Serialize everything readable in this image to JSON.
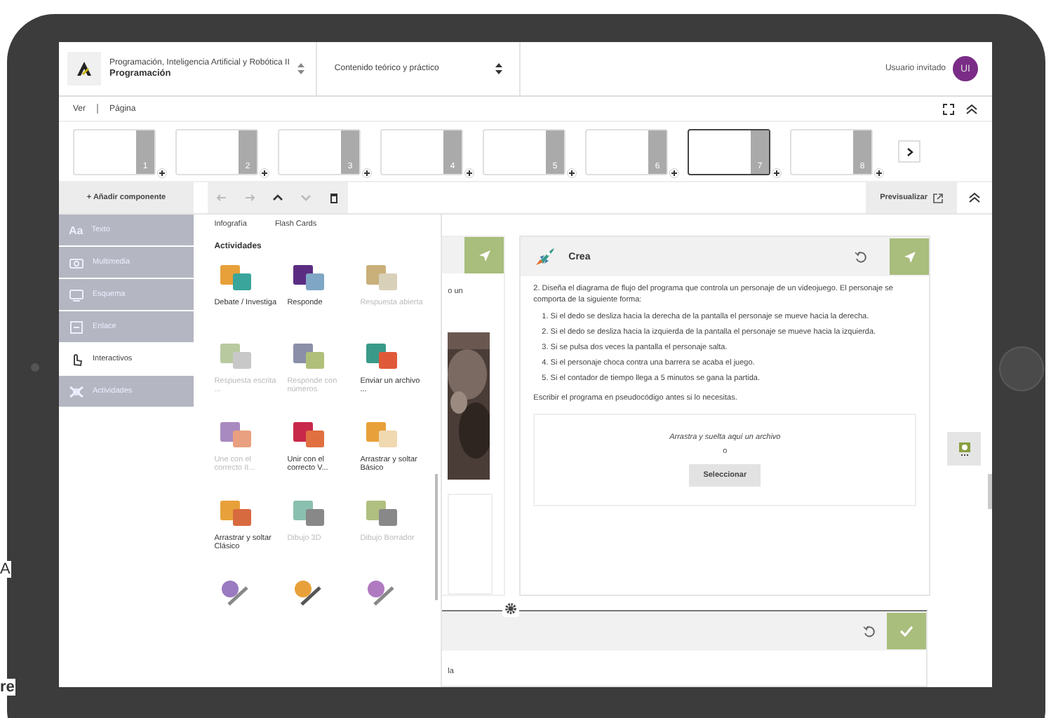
{
  "background_texts": [
    "A",
    "re"
  ],
  "header": {
    "course": "Programación, Inteligencia Artificial y Robótica II",
    "unit": "Programación",
    "section": "Contenido teórico y práctico",
    "user": "Usuario invitado",
    "initials": "UI"
  },
  "menu": [
    "Ver",
    "Página"
  ],
  "pages": [
    {
      "number": "1",
      "selected": false
    },
    {
      "number": "2",
      "selected": false
    },
    {
      "number": "3",
      "selected": false
    },
    {
      "number": "4",
      "selected": false
    },
    {
      "number": "5",
      "selected": false
    },
    {
      "number": "6",
      "selected": false
    },
    {
      "number": "7",
      "selected": true
    },
    {
      "number": "8",
      "selected": false
    }
  ],
  "toolbar": {
    "add": "+ Añadir componente",
    "buttons": [
      {
        "kind": "left",
        "disabled": true
      },
      {
        "kind": "right",
        "disabled": true
      },
      {
        "kind": "up",
        "disabled": false
      },
      {
        "kind": "down",
        "disabled": true
      },
      {
        "kind": "trash",
        "disabled": false
      }
    ],
    "preview": "Previsualizar"
  },
  "sidebar": [
    {
      "kind": "text",
      "glyph": "Aa",
      "label": "Texto",
      "selected": false
    },
    {
      "kind": "media",
      "label": "Multimedia",
      "selected": false
    },
    {
      "kind": "scheme",
      "label": "Esquema",
      "selected": false
    },
    {
      "kind": "link",
      "label": "Enlace",
      "selected": false
    },
    {
      "kind": "interactive",
      "label": "Interactivos",
      "selected": true
    },
    {
      "kind": "activity",
      "label": "Actividades",
      "selected": false
    }
  ],
  "palette": {
    "top_items": [
      "Infografía",
      "Flash Cards"
    ],
    "heading": "Actividades",
    "items": [
      {
        "kind": "tile",
        "label": "Debate / Investiga",
        "disabled": false
      },
      {
        "kind": "tile",
        "label": "Responde",
        "disabled": false
      },
      {
        "kind": "tile",
        "label": "Respuesta abierta",
        "disabled": true
      },
      {
        "kind": "tile",
        "label": "Respuesta escrita ...",
        "disabled": true
      },
      {
        "kind": "tile",
        "label": "Responde con números",
        "disabled": true
      },
      {
        "kind": "tile",
        "label": "Enviar un archivo ...",
        "disabled": false
      },
      {
        "kind": "tile",
        "label": "Une con el correcto II...",
        "disabled": true
      },
      {
        "kind": "tile",
        "label": "Unir con el correcto V...",
        "disabled": false
      },
      {
        "kind": "tile",
        "label": "Arrastrar y soltar Básico",
        "disabled": false
      },
      {
        "kind": "tile",
        "label": "Arrastrar y soltar Clásico",
        "disabled": false
      },
      {
        "kind": "tile",
        "label": "Dibujo 3D",
        "disabled": true
      },
      {
        "kind": "tile",
        "label": "Dibujo Borrador",
        "disabled": true
      },
      {
        "kind": "cut"
      },
      {
        "kind": "cut"
      },
      {
        "kind": "cut"
      }
    ]
  },
  "left_card": {
    "text": "o un"
  },
  "crea_card": {
    "title": "Crea",
    "intro": "2. Diseña el diagrama de flujo del programa que controla un personaje de un videojuego. El personaje se comporta de la siguiente forma:",
    "steps": [
      "1. Si el dedo se desliza hacia la derecha de la pantalla el personaje se mueve hacia la derecha.",
      "2. Si el dedo se desliza hacia la izquierda de la pantalla el personaje se mueve hacia la izquierda.",
      "3. Si se pulsa dos veces la pantalla el personaje salta.",
      "4. Si el personaje choca contra una barrera se acaba el juego.",
      "5. Si el contador de tiempo llega a 5 minutos se gana la partida."
    ],
    "closing": "Escribir el programa en pseudocódigo antes si lo necesitas.",
    "drop_hint": "Arrastra y suelta aquí un archivo",
    "or": "o",
    "button": "Seleccionar"
  },
  "bottom_card": {
    "text": "la"
  }
}
